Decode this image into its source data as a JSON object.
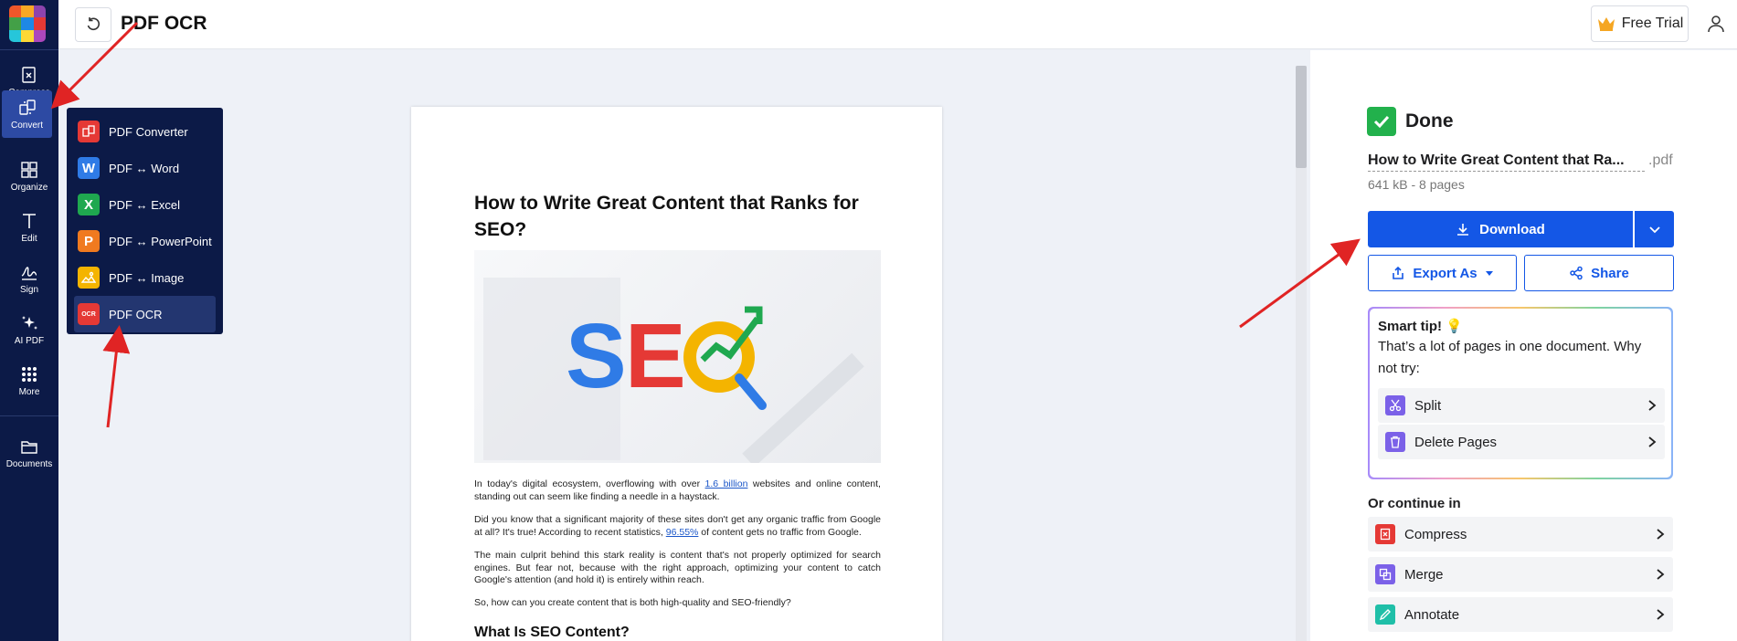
{
  "app": {
    "title": "PDF OCR",
    "free_trial_label": "Free Trial"
  },
  "rail": {
    "items": [
      {
        "label": "Compress",
        "icon": "compress-icon"
      },
      {
        "label": "Convert",
        "icon": "convert-icon",
        "active": true
      },
      {
        "label": "Organize",
        "icon": "grid-icon"
      },
      {
        "label": "Edit",
        "icon": "text-icon"
      },
      {
        "label": "Sign",
        "icon": "signature-icon"
      },
      {
        "label": "AI PDF",
        "icon": "sparkle-icon"
      },
      {
        "label": "More",
        "icon": "dots-grid-icon"
      },
      {
        "label": "Documents",
        "icon": "folder-icon"
      }
    ]
  },
  "convert_menu": {
    "items": [
      {
        "label": "PDF Converter",
        "color": "#e53935"
      },
      {
        "label": "PDF ↔ Word",
        "color": "#2f7be6",
        "glyph": "W"
      },
      {
        "label": "PDF ↔ Excel",
        "color": "#1fa84f",
        "glyph": "X"
      },
      {
        "label": "PDF ↔ PowerPoint",
        "color": "#f07a1f",
        "glyph": "P"
      },
      {
        "label": "PDF ↔ Image",
        "color": "#f4b400"
      },
      {
        "label": "PDF OCR",
        "color": "#e53935",
        "glyph": "OCR",
        "active": true
      }
    ]
  },
  "document": {
    "title": "How to Write Great Content that Ranks for SEO?",
    "hero_text": "SEO",
    "p1_before": "In today's digital ecosystem, overflowing with over ",
    "p1_link": "1.6 billion",
    "p1_after": " websites and online content, standing out can seem like finding a needle in a haystack.",
    "p2_before": "Did you know that a significant majority of these sites don't get any organic traffic from Google at all? It's true! According to recent statistics, ",
    "p2_link": "96.55%",
    "p2_after": " of content gets no traffic from Google.",
    "p3": "The main culprit behind this stark reality is content that's not properly optimized for search engines. But fear not, because with the right approach, optimizing your content to catch Google's attention (and hold it) is entirely within reach.",
    "p4": "So, how can you create content that is both high-quality and SEO-friendly?",
    "h2": "What Is SEO Content?"
  },
  "result": {
    "status": "Done",
    "file_name": "How to Write Great Content that Ra...",
    "file_ext": ".pdf",
    "file_meta": "641 kB - 8 pages",
    "download_label": "Download",
    "export_label": "Export As",
    "share_label": "Share"
  },
  "smart_tip": {
    "title": "Smart tip! 💡",
    "body": "That’s a lot of pages in one document. Why not try:",
    "items": [
      {
        "label": "Split",
        "color": "#7b61e8"
      },
      {
        "label": "Delete Pages",
        "color": "#7b61e8"
      }
    ]
  },
  "continue": {
    "title": "Or continue in",
    "items": [
      {
        "label": "Compress",
        "color": "#e53935"
      },
      {
        "label": "Merge",
        "color": "#7b61e8"
      },
      {
        "label": "Annotate",
        "color": "#1fbfa8"
      }
    ]
  },
  "colors": {
    "rail_bg": "#0c1a47",
    "accent": "#1457e6",
    "done": "#22b14c",
    "arrow": "#e02424"
  }
}
